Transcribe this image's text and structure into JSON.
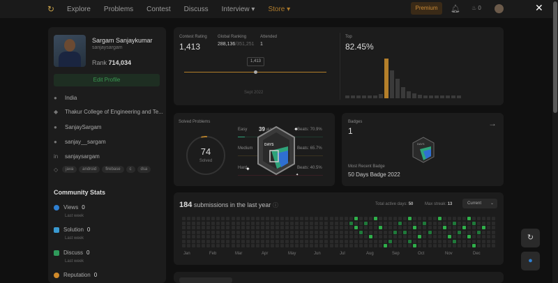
{
  "nav": {
    "links": [
      "Explore",
      "Problems",
      "Contest",
      "Discuss",
      "Interview ▾",
      "Store ▾"
    ],
    "premium": "Premium",
    "fire_count": "0"
  },
  "profile": {
    "name": "Sargam Sanjaykumar",
    "username": "sanjaysargam",
    "rank_label": "Rank",
    "rank_value": "714,034",
    "edit_label": "Edit Profile",
    "location": "India",
    "college": "Thakur College of Engineering and Te...",
    "github": "SanjaySargam",
    "twitter": "sanjay__sargam",
    "linkedin": "sanjaysargam",
    "tags": [
      "java",
      "android",
      "firebase",
      "c",
      "dsa"
    ]
  },
  "community": {
    "title": "Community Stats",
    "items": [
      {
        "label": "Views",
        "value": "0",
        "sub": "Last week",
        "color": "#2f7fd1"
      },
      {
        "label": "Solution",
        "value": "0",
        "sub": "Last week",
        "color": "#3a9ad1"
      },
      {
        "label": "Discuss",
        "value": "0",
        "sub": "Last week",
        "color": "#2f9a5a"
      },
      {
        "label": "Reputation",
        "value": "0",
        "sub": "",
        "color": "#d08a2a"
      }
    ]
  },
  "contest": {
    "rating_label": "Contest Rating",
    "rating_value": "1,413",
    "global_label": "Global Ranking",
    "global_value": "288,136",
    "global_total": "/351,251",
    "attended_label": "Attended",
    "attended_value": "1",
    "tooltip": "1,413",
    "date": "Sept 2022",
    "top_label": "Top",
    "top_value": "82.45%"
  },
  "solved": {
    "title": "Solved Problems",
    "total": "74",
    "total_label": "Solved",
    "rows": [
      {
        "label": "Easy",
        "value": "39",
        "total": "/618",
        "beats": "Beats: 70.9%",
        "color": "#2fa37a"
      },
      {
        "label": "Medium",
        "value": "",
        "total": "",
        "beats": "Beats: 65.7%",
        "color": "#c9a22a"
      },
      {
        "label": "Hard",
        "value": "",
        "total": "",
        "beats": "Beats: 40.5%",
        "color": "#c9344a"
      }
    ]
  },
  "badge_overlay": {
    "label": "DAYS"
  },
  "badges": {
    "title": "Badges",
    "count": "1",
    "recent_label": "Most Recent Badge",
    "recent_name": "50 Days Badge 2022",
    "badge_text": "DAYS"
  },
  "submissions": {
    "count": "184",
    "label": "submissions in the last year",
    "active_label": "Total active days:",
    "active_value": "50",
    "streak_label": "Max streak:",
    "streak_value": "13",
    "select": "Current",
    "months": [
      "Jan",
      "Feb",
      "Mar",
      "Apr",
      "May",
      "Jun",
      "Jul",
      "Aug",
      "Sep",
      "Oct",
      "Nov",
      "Dec"
    ]
  },
  "colors": {
    "accent": "#b47f2a",
    "green": "#2f9a4a"
  }
}
